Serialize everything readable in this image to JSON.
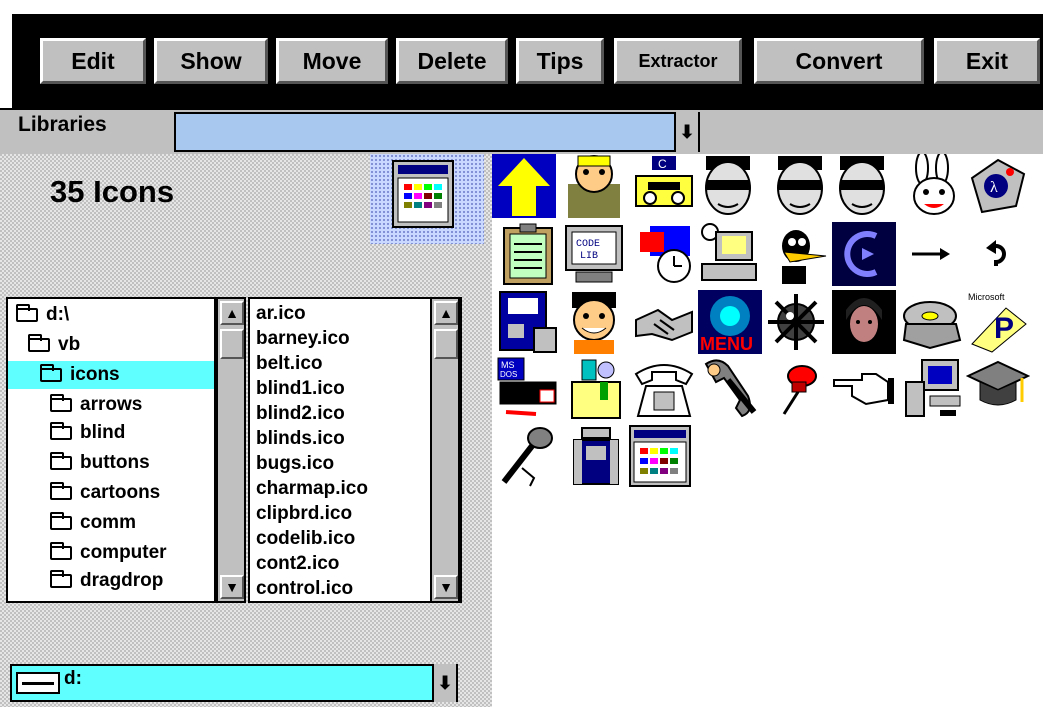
{
  "toolbar": {
    "buttons": [
      "Edit",
      "Show",
      "Move",
      "Delete",
      "Tips",
      "Extractor",
      "Convert",
      "Exit"
    ]
  },
  "libraries": {
    "label": "Libraries",
    "value": ""
  },
  "summary": {
    "count_text": "35 Icons"
  },
  "directories": {
    "items": [
      "d:\\",
      "vb",
      "icons",
      "arrows",
      "blind",
      "buttons",
      "cartoons",
      "comm",
      "computer",
      "dragdrop"
    ],
    "selected": "icons"
  },
  "files": {
    "items": [
      "ar.ico",
      "barney.ico",
      "belt.ico",
      "blind1.ico",
      "blind2.ico",
      "blinds.ico",
      "bugs.ico",
      "charmap.ico",
      "clipbrd.ico",
      "codelib.ico",
      "cont2.ico",
      "control.ico"
    ]
  },
  "drive": {
    "value": "d:"
  },
  "icons": [
    "up-arrow-icon",
    "barney-icon",
    "belt-tape-player-icon",
    "blind1-icon",
    "blind2-icon",
    "blinds-icon",
    "bugs-bunny-icon",
    "charmap-icon",
    "clipboard-icon",
    "codelib-icon",
    "cont2-icon",
    "control-icon",
    "daffy-duck-icon",
    "dark-c-icon",
    "arrow-right-icon",
    "return-arrow-icon",
    "floppy-computer-icon",
    "fred-flintstone-icon",
    "handshake-icon",
    "menu-icon",
    "mine-icon",
    "face-icon",
    "film-reel-icon",
    "microsoft-project-icon",
    "msdos-printer-icon",
    "toolbox-icon",
    "telephone-icon",
    "phone-hand-icon",
    "pushpin-icon",
    "pointing-hand-icon",
    "computer-icon",
    "graduation-cap-icon",
    "microphone-icon",
    "paint-can-icon",
    "palette-window-icon"
  ],
  "colors": {
    "selection": "#60ffff",
    "libraries_field": "#a8c8f0",
    "face_panel": "#c0c0c0"
  }
}
